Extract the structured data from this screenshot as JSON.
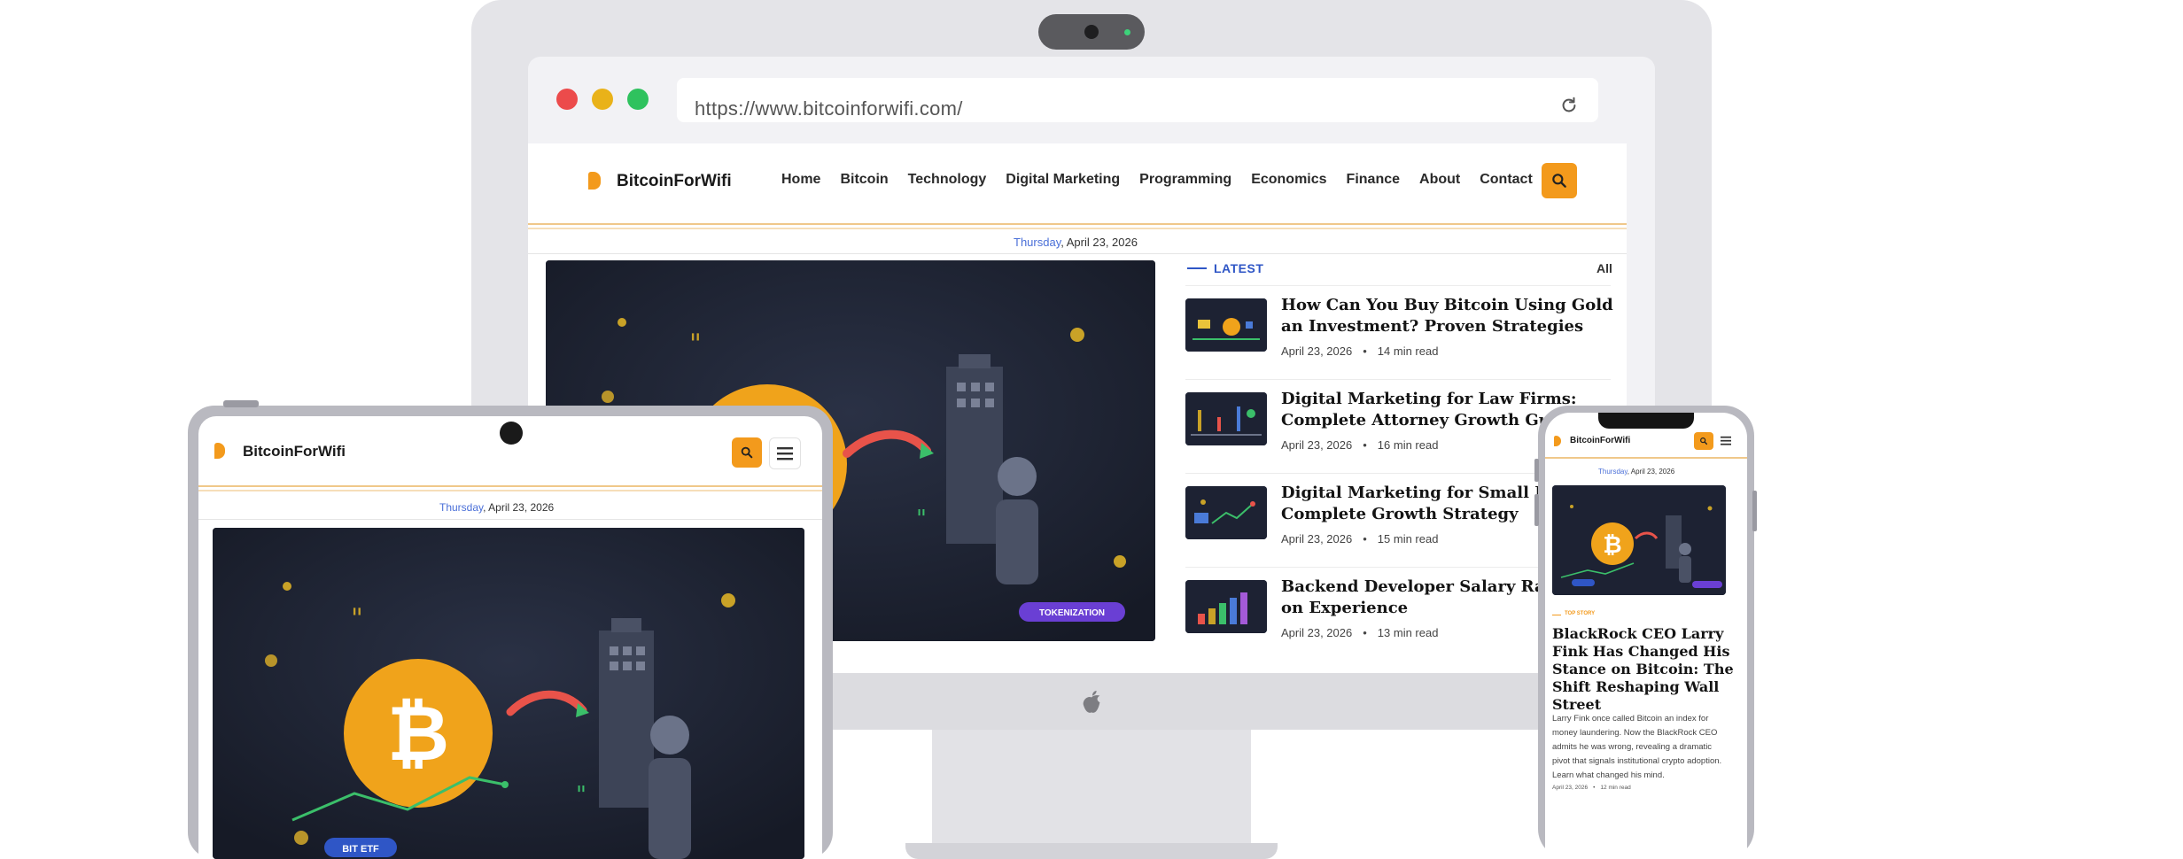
{
  "browser": {
    "url": "https://www.bitcoinforwifi.com/"
  },
  "site": {
    "brand": "BitcoinForWifi",
    "nav": [
      "Home",
      "Bitcoin",
      "Technology",
      "Digital Marketing",
      "Programming",
      "Economics",
      "Finance",
      "About",
      "Contact"
    ],
    "date_day": "Thursday",
    "date_rest": ", April 23, 2026",
    "hero_badge": "TOKENIZATION",
    "latest_label": "LATEST",
    "all_label": "All",
    "articles": [
      {
        "title_1": "How Can You Buy Bitcoin Using Gold as",
        "title_2": "an Investment? Proven Strategies",
        "date": "April 23, 2026",
        "read": "14 min read"
      },
      {
        "title_1": "Digital Marketing for Law Firms:",
        "title_2": "Complete Attorney Growth Guid",
        "date": "April 23, 2026",
        "read": "16 min read"
      },
      {
        "title_1": "Digital Marketing for Small Busi",
        "title_2": "Complete Growth Strategy",
        "date": "April 23, 2026",
        "read": "15 min read"
      },
      {
        "title_1": "Backend Developer Salary Range",
        "title_2": "on Experience",
        "date": "April 23, 2026",
        "read": "13 min read"
      }
    ],
    "meta_sep": "•"
  },
  "tablet": {
    "brand": "BitcoinForWifi",
    "date_day": "Thursday",
    "date_rest": ", April 23, 2026",
    "hero_badge": "BIT ETF"
  },
  "phone": {
    "brand": "BitcoinForWifi",
    "date_day": "Thursday",
    "date_rest": ", April 23, 2026",
    "section": "TOP STORY",
    "headline": "BlackRock CEO Larry Fink Has Changed His Stance on Bitcoin: The Shift Reshaping Wall Street",
    "excerpt": "Larry Fink once called Bitcoin an index for money laundering. Now the BlackRock CEO admits he was wrong, revealing a dramatic pivot that signals institutional crypto adoption. Learn what changed his mind.",
    "meta_date": "April 23, 2026",
    "meta_read": "12 min read",
    "meta_sep": "•"
  },
  "icons": {
    "search": "search-icon",
    "menu": "hamburger-menu-icon",
    "reload": "reload-icon",
    "apple": "apple-logo-icon",
    "bitcoin": "bitcoin-icon"
  },
  "colors": {
    "accent": "#f39a1c",
    "link_blue": "#2f56c6",
    "hero_bg": "#1b2030",
    "traffic_red": "#ec4b4b",
    "traffic_yellow": "#e9b219",
    "traffic_green": "#2fc25e",
    "badge_purple": "#6a3fd4"
  }
}
